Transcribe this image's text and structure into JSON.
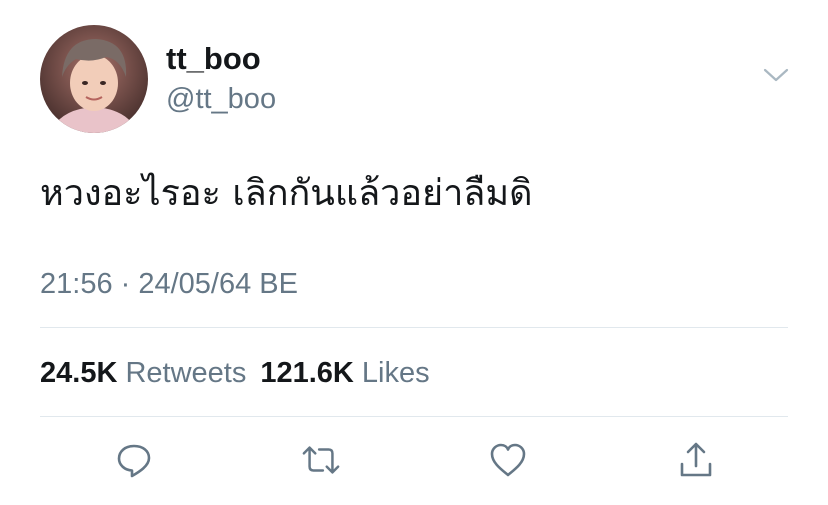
{
  "tweet": {
    "author": {
      "display_name": "tt_boo",
      "handle": "@tt_boo",
      "avatar_icon": "profile-photo"
    },
    "text": "หวงอะไรอะ เลิกกันแล้วอย่าลืมดิ",
    "timestamp": "21:56 · 24/05/64 BE",
    "stats": {
      "retweets_count": "24.5K",
      "retweets_label": "Retweets",
      "likes_count": "121.6K",
      "likes_label": "Likes"
    },
    "actions": [
      {
        "name": "reply",
        "icon": "speech-bubble-icon"
      },
      {
        "name": "retweet",
        "icon": "retweet-arrows-icon"
      },
      {
        "name": "like",
        "icon": "heart-icon"
      },
      {
        "name": "share",
        "icon": "share-upload-icon"
      }
    ]
  },
  "colors": {
    "primary_text": "#14171a",
    "secondary_text": "#657786",
    "divider": "#e1e8ed",
    "icon": "#657786"
  }
}
